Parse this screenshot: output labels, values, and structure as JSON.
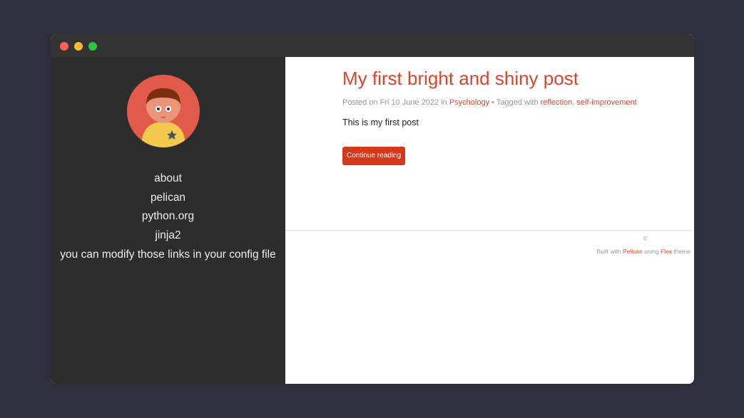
{
  "window": {
    "controls": [
      "close",
      "minimize",
      "maximize"
    ]
  },
  "sidebar": {
    "avatar": "avatar-illustration",
    "links": [
      {
        "label": "about"
      },
      {
        "label": "pelican"
      },
      {
        "label": "python.org"
      },
      {
        "label": "jinja2"
      },
      {
        "label": "you can modify those links in your config file"
      }
    ]
  },
  "post": {
    "title": "My first bright and shiny post",
    "meta": {
      "posted_prefix": "Posted on Fri 10 June 2022 in ",
      "category": "Psychology",
      "tagged_prefix": " • Tagged with ",
      "tags": [
        "reflection",
        "self-improvement"
      ],
      "tag_separator": ", "
    },
    "summary": "This is my first post",
    "continue_label": "Continue reading"
  },
  "footer": {
    "copyright": "©",
    "built_prefix": "Built with ",
    "pelican": "Pelican",
    "using": " using ",
    "flex": "Flex",
    "theme": " theme"
  },
  "colors": {
    "background": "#2f2f3b",
    "sidebar": "#2d2d2d",
    "accent": "#d9452b",
    "button": "#d5381a"
  }
}
